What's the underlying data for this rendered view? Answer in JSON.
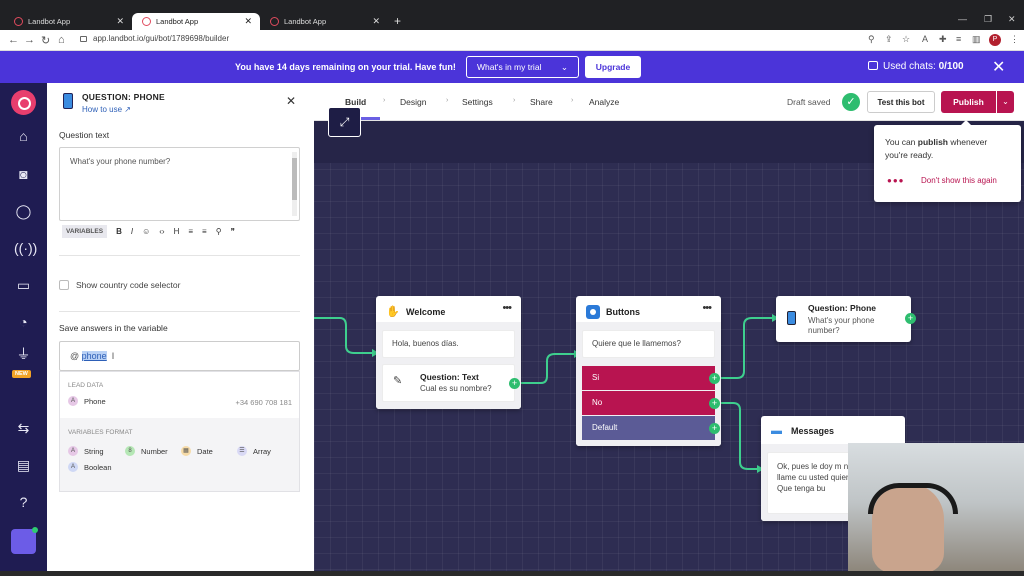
{
  "browser": {
    "tabs": [
      {
        "label": "Landbot App",
        "active": false
      },
      {
        "label": "Landbot App",
        "active": true
      },
      {
        "label": "Landbot App",
        "active": false
      }
    ],
    "url": "app.landbot.io/gui/bot/1789698/builder",
    "profile_initial": "P"
  },
  "banner": {
    "message": "You have 14 days remaining on your trial. Have fun!",
    "trial_select": "What's in my trial",
    "upgrade_label": "Upgrade",
    "used_chats_label": "Used chats:",
    "used_chats_value": "0/100"
  },
  "rail": {
    "new_badge": "NEW"
  },
  "panel": {
    "title": "QUESTION: PHONE",
    "how_to_use": "How to use",
    "question_text_label": "Question text",
    "question_text_value": "What's your phone number?",
    "variables_button": "VARIABLES",
    "toolbar_icons": [
      "B",
      "I",
      "☺",
      "‹›",
      "H",
      "≡",
      "≡",
      "⚲",
      "❞"
    ],
    "country_code_label": "Show country code selector",
    "save_answers_label": "Save answers in the variable",
    "variable_prefix": "@",
    "variable_value": "phone",
    "lead_data_label": "LEAD DATA",
    "lead_item": {
      "badge": "A",
      "label": "Phone",
      "value": "+34 690 708 181"
    },
    "variables_format_label": "VARIABLES FORMAT",
    "formats": [
      {
        "badge": "A",
        "label": "String",
        "color": "#e6c8e6"
      },
      {
        "badge": "8",
        "label": "Number",
        "color": "#b5e7b5"
      },
      {
        "badge": "▦",
        "label": "Date",
        "color": "#f6dba8"
      },
      {
        "badge": "☰",
        "label": "Array",
        "color": "#d9d9f5"
      },
      {
        "badge": "A",
        "label": "Boolean",
        "color": "#cfd8f5"
      }
    ]
  },
  "builder_bar": {
    "tabs": [
      "Build",
      "Design",
      "Settings",
      "Share",
      "Analyze"
    ],
    "active_tab": "Build",
    "draft_status": "Draft saved",
    "test_label": "Test this bot",
    "publish_label": "Publish"
  },
  "tooltip": {
    "text_prefix": "You can ",
    "text_bold": "publish",
    "text_suffix": " whenever you're ready.",
    "dismiss_label": "Don't show this again"
  },
  "nodes": {
    "welcome": {
      "title": "Welcome",
      "bubble": "Hola, buenos días.",
      "question_title": "Question: Text",
      "question_sub": "Cual es su nombre?"
    },
    "buttons": {
      "title": "Buttons",
      "bubble": "Quiere que le llamemos?",
      "choices": [
        {
          "label": "Si",
          "color": "#b81450"
        },
        {
          "label": "No",
          "color": "#b81450"
        },
        {
          "label": "Default",
          "color": "#5b5b96"
        }
      ]
    },
    "phone": {
      "title": "Question: Phone",
      "sub": "What's your phone number?"
    },
    "messages": {
      "title": "Messages",
      "body": "Ok, pues le doy m número y llame cu usted quiera: 645 645. Que tenga bu"
    }
  },
  "colors": {
    "brand": "#4b34d9",
    "publish": "#b81450",
    "edge": "#3ecf8e",
    "canvas": "#2e2d52"
  }
}
